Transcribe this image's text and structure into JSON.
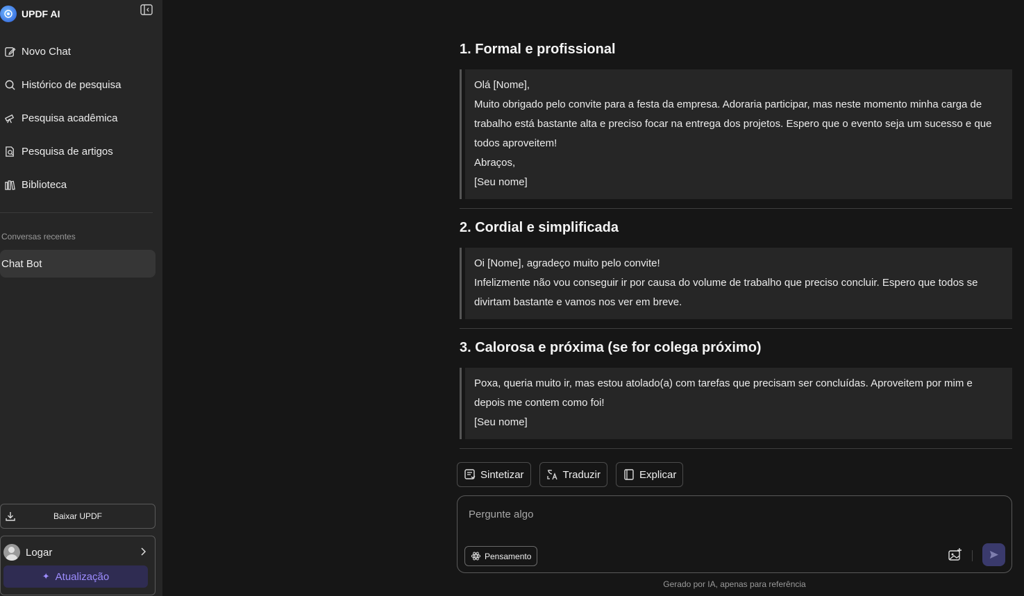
{
  "app": {
    "name": "UPDF AI"
  },
  "sidebar": {
    "nav": [
      {
        "label": "Novo Chat",
        "icon": "edit-icon"
      },
      {
        "label": "Histórico de pesquisa",
        "icon": "search-icon"
      },
      {
        "label": "Pesquisa acadêmica",
        "icon": "telescope-icon"
      },
      {
        "label": "Pesquisa de artigos",
        "icon": "doc-search-icon"
      },
      {
        "label": "Biblioteca",
        "icon": "library-icon"
      }
    ],
    "recent_label": "Conversas recentes",
    "recent": [
      {
        "label": "Chat Bot"
      }
    ],
    "download_label": "Baixar UPDF",
    "login_label": "Logar",
    "upgrade_label": "Atualização"
  },
  "chat": {
    "sections": [
      {
        "title": "1. Formal e profissional",
        "lines": [
          "Olá [Nome],",
          "Muito obrigado pelo convite para a festa da empresa. Adoraria participar, mas neste momento minha carga de",
          "trabalho está bastante alta e preciso focar na entrega dos projetos. Espero que o evento seja um sucesso e que",
          "todos aproveitem!",
          "Abraços,",
          "[Seu nome]"
        ]
      },
      {
        "title": "2. Cordial e simplificada",
        "lines": [
          "Oi [Nome], agradeço muito pelo convite!",
          "Infelizmente não vou conseguir ir por causa do volume de trabalho que preciso concluir. Espero que todos se",
          "divirtam bastante e vamos nos ver em breve."
        ]
      },
      {
        "title": "3. Calorosa e próxima (se for colega próximo)",
        "lines": [
          "Poxa, queria muito ir, mas estou atolado(a) com tarefas que precisam ser concluídas. Aproveitem por mim e",
          "depois me contem como foi!",
          "[Seu nome]"
        ]
      }
    ]
  },
  "actions": [
    {
      "label": "Sintetizar",
      "icon": "summarize-icon"
    },
    {
      "label": "Traduzir",
      "icon": "translate-icon"
    },
    {
      "label": "Explicar",
      "icon": "book-icon"
    }
  ],
  "input": {
    "placeholder": "Pergunte algo",
    "thinking_label": "Pensamento"
  },
  "footer": {
    "note": "Gerado por IA, apenas para referência"
  },
  "colors": {
    "accent": "#9d8dff",
    "upgrade_bg": "#2f2c52",
    "send_bg": "#3a3a6c"
  }
}
